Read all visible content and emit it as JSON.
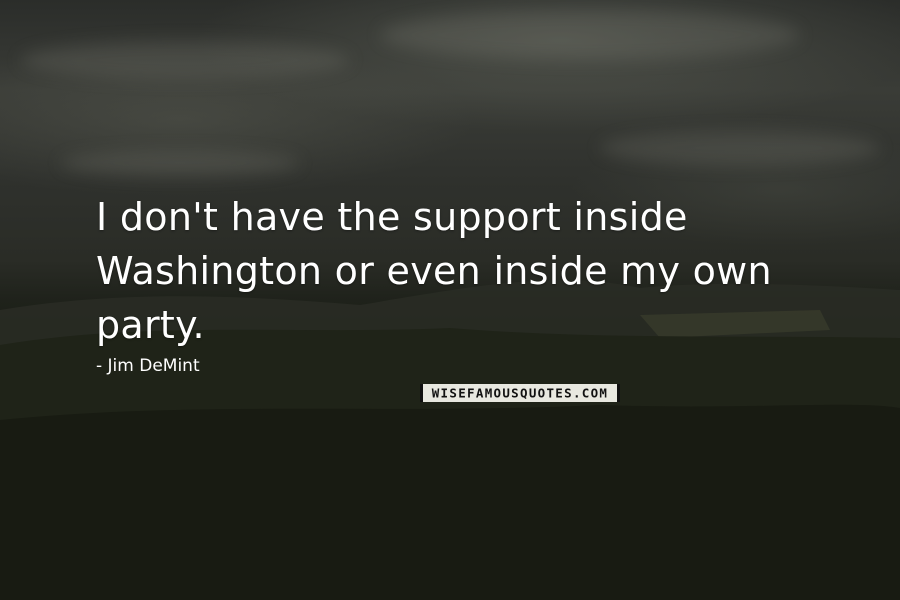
{
  "quote": {
    "text": "I don't have the support inside Washington or even inside my own party.",
    "author": "- Jim DeMint"
  },
  "watermark": {
    "text": "WISEFAMOUSQUOTES.COM"
  },
  "colors": {
    "text": "#ffffff",
    "sky": "#3a3c37",
    "forest": "#191c13",
    "watermark_bg": "#e8e8e0"
  }
}
